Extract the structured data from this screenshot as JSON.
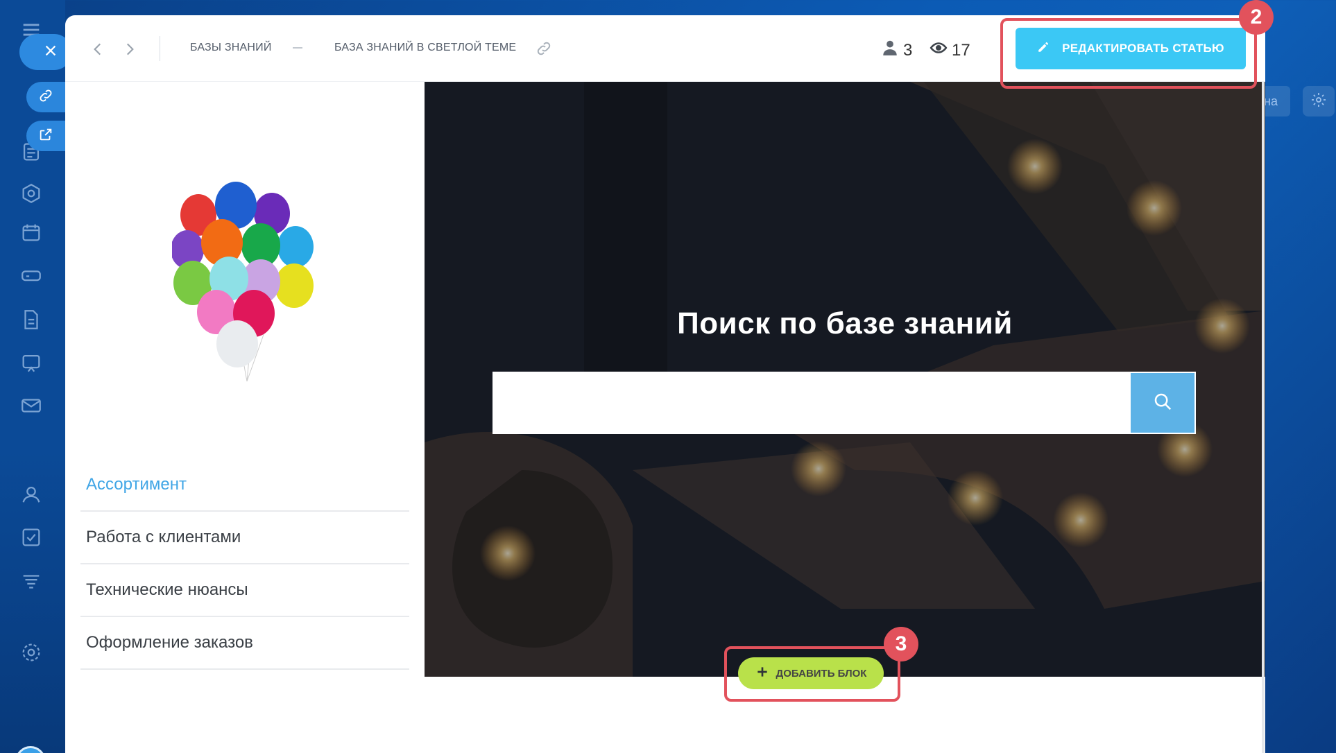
{
  "topbar": {
    "breadcrumb": [
      "БАЗЫ ЗНАНИЙ",
      "БАЗА ЗНАНИЙ В СВЕТЛОЙ ТЕМЕ"
    ],
    "users_count": "3",
    "views_count": "17",
    "edit_button": "РЕДАКТИРОВАТЬ СТАТЬЮ"
  },
  "menu": {
    "items": [
      {
        "label": "Ассортимент",
        "active": true
      },
      {
        "label": "Работа с клиентами",
        "active": false
      },
      {
        "label": "Технические нюансы",
        "active": false
      },
      {
        "label": "Оформление заказов",
        "active": false
      }
    ]
  },
  "hero": {
    "title": "Поиск по базе знаний",
    "search_placeholder": ""
  },
  "add_block": {
    "label": "ДОБАВИТЬ БЛОК"
  },
  "annotations": {
    "badge_edit": "2",
    "badge_add": "3"
  },
  "background": {
    "right_tab_text": "на"
  },
  "colors": {
    "accent": "#3bc8f5",
    "highlight": "#e2525c",
    "add_block": "#b9e14a",
    "active_menu": "#41a6e6"
  },
  "icons": [
    "close-icon",
    "link-icon",
    "external-link-icon",
    "news-icon",
    "hexagon-icon",
    "calendar-icon",
    "drive-icon",
    "document-icon",
    "bo-icon",
    "mail-icon",
    "contacts-icon",
    "tasks-icon",
    "filter-icon",
    "settings-icon",
    "chevron-left-icon",
    "chevron-right-icon",
    "user-icon",
    "eye-icon",
    "pencil-icon",
    "search-icon",
    "plus-icon",
    "gear-icon"
  ]
}
